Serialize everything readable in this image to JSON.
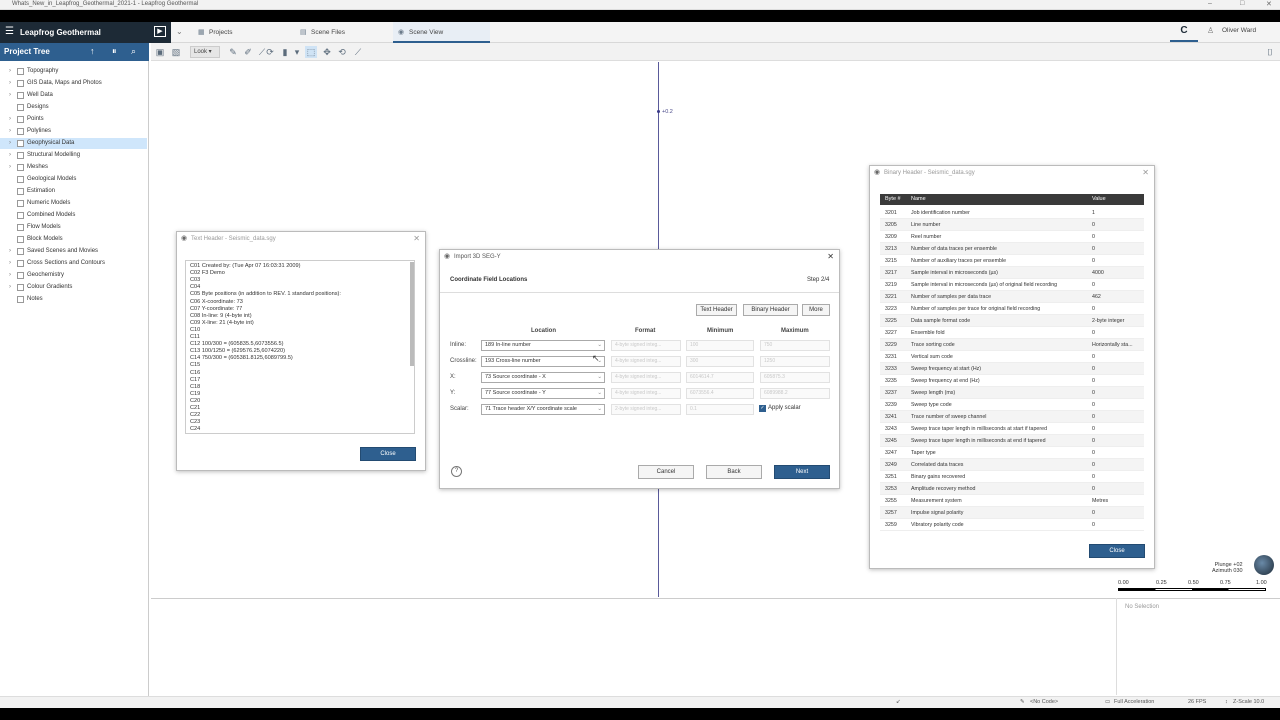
{
  "window": {
    "title": "Whats_New_in_Leapfrog_Geothermal_2021-1 - Leapfrog Geothermal",
    "min": "–",
    "max": "□",
    "close": "✕"
  },
  "app": {
    "brand": "Leapfrog Geothermal",
    "tabs": [
      {
        "label": "Projects"
      },
      {
        "label": "Scene Files"
      },
      {
        "label": "Scene View"
      }
    ],
    "user": "Oliver Ward"
  },
  "project_tree": {
    "title": "Project Tree",
    "items": [
      {
        "label": "Topography",
        "expand": true
      },
      {
        "label": "GIS Data, Maps and Photos",
        "expand": true
      },
      {
        "label": "Well Data",
        "expand": true
      },
      {
        "label": "Designs",
        "expand": false
      },
      {
        "label": "Points",
        "expand": true
      },
      {
        "label": "Polylines",
        "expand": true
      },
      {
        "label": "Geophysical Data",
        "expand": true,
        "selected": true
      },
      {
        "label": "Structural Modelling",
        "expand": true
      },
      {
        "label": "Meshes",
        "expand": true
      },
      {
        "label": "Geological Models",
        "expand": false
      },
      {
        "label": "Estimation",
        "expand": false
      },
      {
        "label": "Numeric Models",
        "expand": false
      },
      {
        "label": "Combined Models",
        "expand": false
      },
      {
        "label": "Flow Models",
        "expand": false
      },
      {
        "label": "Block Models",
        "expand": false
      },
      {
        "label": "Saved Scenes and Movies",
        "expand": true
      },
      {
        "label": "Cross Sections and Contours",
        "expand": true
      },
      {
        "label": "Geochemistry",
        "expand": true
      },
      {
        "label": "Colour Gradients",
        "expand": true
      },
      {
        "label": "Notes",
        "expand": false
      }
    ]
  },
  "toolbar": {
    "look_label": "Look"
  },
  "scene": {
    "point_label": "+0.2",
    "no_selection": "No Selection",
    "plunge": "Plunge +02",
    "azimuth": "Azimuth 030",
    "scale_labels": [
      "0.00",
      "0.25",
      "0.50",
      "0.75",
      "1.00"
    ]
  },
  "status": {
    "code": "<No Code>",
    "accel": "Full Acceleration",
    "fps": "26 FPS",
    "zscale": "Z-Scale 10.0"
  },
  "text_header": {
    "title": "Text Header - Seismic_data.sgy",
    "lines": [
      "C01 Created by: (Tue Apr 07 16:03:31 2009)",
      "C02 F3 Demo",
      "C03",
      "C04",
      "C05 Byte positions (in addition to REV. 1 standard positions):",
      "C06 X-coordinate: 73",
      "C07 Y-coordinate: 77",
      "C08 In-line: 9 (4-byte int)",
      "C09 X-line: 21 (4-byte int)",
      "C10",
      "C11",
      "C12 100/300 = (605835.5,6073556.5)",
      "C13 100/1250 = (629576.25,6074220)",
      "C14 750/300 = (605381.8125,6089799.5)",
      "C15",
      "C16",
      "C17",
      "C18",
      "C19",
      "C20",
      "C21",
      "C22",
      "C23",
      "C24",
      "C25"
    ],
    "close_label": "Close"
  },
  "import_dialog": {
    "title": "Import 3D SEG-Y",
    "section": "Coordinate Field Locations",
    "step": "Step 2/4",
    "buttons": {
      "text_header": "Text Header",
      "binary_header": "Binary Header",
      "more": "More"
    },
    "columns": {
      "location": "Location",
      "format": "Format",
      "minimum": "Minimum",
      "maximum": "Maximum"
    },
    "rows": [
      {
        "label": "Inline:",
        "location": "189 In-line number",
        "format": "4-byte signed integ...",
        "min": "100",
        "max": "750"
      },
      {
        "label": "Crossline:",
        "location": "193 Cross-line number",
        "format": "4-byte signed integ...",
        "min": "300",
        "max": "1250"
      },
      {
        "label": "X:",
        "location": "73 Source coordinate - X",
        "format": "4-byte signed integ...",
        "min": "6014614.7",
        "max": "605875.3"
      },
      {
        "label": "Y:",
        "location": "77 Source coordinate - Y",
        "format": "4-byte signed integ...",
        "min": "6073556.4",
        "max": "6089988.2"
      },
      {
        "label": "Scalar:",
        "location": "71 Trace header X/Y coordinate scale",
        "format": "2-byte signed integ...",
        "min": "0.1",
        "max": ""
      }
    ],
    "apply_scalar": "Apply scalar",
    "cancel": "Cancel",
    "back": "Back",
    "next": "Next",
    "help": "?"
  },
  "binary_header": {
    "title": "Binary Header - Seismic_data.sgy",
    "cols": {
      "byte": "Byte #",
      "name": "Name",
      "value": "Value"
    },
    "rows": [
      {
        "b": "3201",
        "n": "Job identification number",
        "v": "1"
      },
      {
        "b": "3205",
        "n": "Line number",
        "v": "0"
      },
      {
        "b": "3209",
        "n": "Reel number",
        "v": "0"
      },
      {
        "b": "3213",
        "n": "Number of data traces per ensemble",
        "v": "0"
      },
      {
        "b": "3215",
        "n": "Number of auxiliary traces per ensemble",
        "v": "0"
      },
      {
        "b": "3217",
        "n": "Sample interval in microseconds (µs)",
        "v": "4000"
      },
      {
        "b": "3219",
        "n": "Sample interval in microseconds (µs) of original field recording",
        "v": "0"
      },
      {
        "b": "3221",
        "n": "Number of samples per data trace",
        "v": "462"
      },
      {
        "b": "3223",
        "n": "Number of samples per trace for original field recording",
        "v": "0"
      },
      {
        "b": "3225",
        "n": "Data sample format code",
        "v": "2-byte integer"
      },
      {
        "b": "3227",
        "n": "Ensemble fold",
        "v": "0"
      },
      {
        "b": "3229",
        "n": "Trace sorting code",
        "v": "Horizontally sta..."
      },
      {
        "b": "3231",
        "n": "Vertical sum code",
        "v": "0"
      },
      {
        "b": "3233",
        "n": "Sweep frequency at start (Hz)",
        "v": "0"
      },
      {
        "b": "3235",
        "n": "Sweep frequency at end (Hz)",
        "v": "0"
      },
      {
        "b": "3237",
        "n": "Sweep length (ms)",
        "v": "0"
      },
      {
        "b": "3239",
        "n": "Sweep type code",
        "v": "0"
      },
      {
        "b": "3241",
        "n": "Trace number of sweep channel",
        "v": "0"
      },
      {
        "b": "3243",
        "n": "Sweep trace taper length in milliseconds at start if tapered",
        "v": "0"
      },
      {
        "b": "3245",
        "n": "Sweep trace taper length in milliseconds at end if tapered",
        "v": "0"
      },
      {
        "b": "3247",
        "n": "Taper type",
        "v": "0"
      },
      {
        "b": "3249",
        "n": "Correlated data traces",
        "v": "0"
      },
      {
        "b": "3251",
        "n": "Binary gains recovered",
        "v": "0"
      },
      {
        "b": "3253",
        "n": "Amplitude recovery method",
        "v": "0"
      },
      {
        "b": "3255",
        "n": "Measurement system",
        "v": "Metres"
      },
      {
        "b": "3257",
        "n": "Impulse signal polarity",
        "v": "0"
      },
      {
        "b": "3259",
        "n": "Vibratory polarity code",
        "v": "0"
      }
    ],
    "close_label": "Close"
  }
}
